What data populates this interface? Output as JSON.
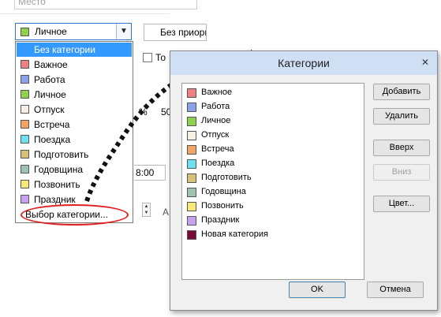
{
  "form": {
    "place_placeholder": "Место",
    "category_value": "Личное",
    "category_value_color": "#8fd14a",
    "priority_value": "Без приоритета",
    "to_label": "То",
    "pct_text": "%",
    "fifty_text": "50",
    "time_text": "8:00",
    "a_text": "А"
  },
  "dropdown": {
    "items": [
      {
        "label": "Без категории",
        "color": "",
        "selected": true
      },
      {
        "label": "Важное",
        "color": "#f08080",
        "selected": false
      },
      {
        "label": "Работа",
        "color": "#8ca2e8",
        "selected": false
      },
      {
        "label": "Личное",
        "color": "#8fd14a",
        "selected": false
      },
      {
        "label": "Отпуск",
        "color": "#f5f0e1",
        "selected": false
      },
      {
        "label": "Встреча",
        "color": "#f4a464",
        "selected": false
      },
      {
        "label": "Поездка",
        "color": "#6ee0f0",
        "selected": false
      },
      {
        "label": "Подготовить",
        "color": "#d8c078",
        "selected": false
      },
      {
        "label": "Годовщина",
        "color": "#9ec4b0",
        "selected": false
      },
      {
        "label": "Позвонить",
        "color": "#f8e878",
        "selected": false
      },
      {
        "label": "Праздник",
        "color": "#c8a0f0",
        "selected": false
      }
    ],
    "pick_label": "Выбор категории..."
  },
  "dialog": {
    "title": "Категории",
    "close_glyph": "✕",
    "categories": [
      {
        "label": "Важное",
        "color": "#f08080"
      },
      {
        "label": "Работа",
        "color": "#8ca2e8"
      },
      {
        "label": "Личное",
        "color": "#8fd14a"
      },
      {
        "label": "Отпуск",
        "color": "#f5f0e1"
      },
      {
        "label": "Встреча",
        "color": "#f4a464"
      },
      {
        "label": "Поездка",
        "color": "#6ee0f0"
      },
      {
        "label": "Подготовить",
        "color": "#d8c078"
      },
      {
        "label": "Годовщина",
        "color": "#9ec4b0"
      },
      {
        "label": "Позвонить",
        "color": "#f8e878"
      },
      {
        "label": "Праздник",
        "color": "#c8a0f0"
      },
      {
        "label": "Новая категория",
        "color": "#7a0a3a"
      }
    ],
    "buttons": {
      "add": "Добавить",
      "delete": "Удалить",
      "up": "Вверх",
      "down": "Вниз",
      "color": "Цвет...",
      "ok": "OK",
      "cancel": "Отмена"
    }
  },
  "icons": {
    "dropdown_arrow": "chevron-down-icon",
    "close": "close-icon"
  }
}
